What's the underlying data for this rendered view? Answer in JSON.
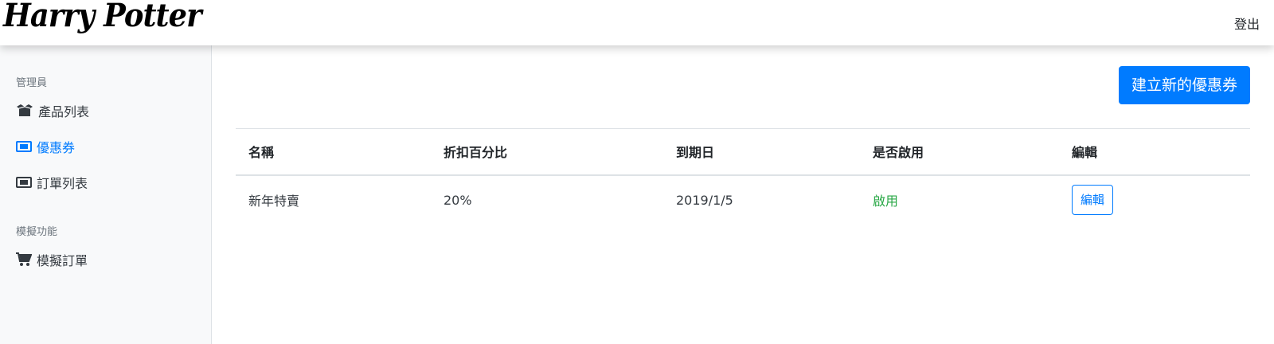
{
  "header": {
    "logo_text": "Harry Potter",
    "logout_label": "登出"
  },
  "sidebar": {
    "sections": [
      {
        "heading": "管理員",
        "items": [
          {
            "label": "產品列表",
            "icon": "box-open-icon",
            "active": false
          },
          {
            "label": "優惠券",
            "icon": "ticket-icon",
            "active": true
          },
          {
            "label": "訂單列表",
            "icon": "ticket-icon",
            "active": false
          }
        ]
      },
      {
        "heading": "模擬功能",
        "items": [
          {
            "label": "模擬訂單",
            "icon": "cart-icon",
            "active": false
          }
        ]
      }
    ]
  },
  "main": {
    "create_button_label": "建立新的優惠券",
    "table": {
      "columns": [
        "名稱",
        "折扣百分比",
        "到期日",
        "是否啟用",
        "編輯"
      ],
      "rows": [
        {
          "name": "新年特賣",
          "discount": "20%",
          "due_date": "2019/1/5",
          "status": "啟用",
          "edit_label": "編輯"
        }
      ]
    }
  },
  "colors": {
    "primary": "#007bff",
    "success": "#28a745",
    "sidebar_bg": "#f8f9fa"
  }
}
